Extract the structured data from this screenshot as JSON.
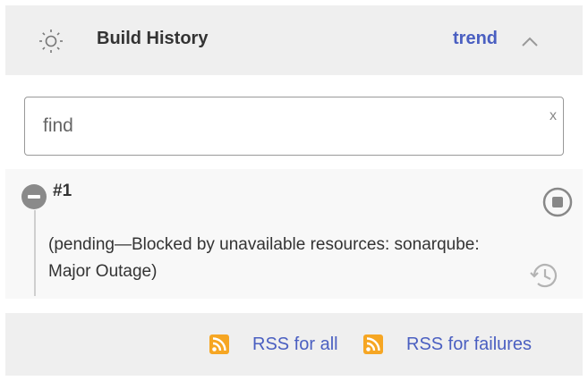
{
  "header": {
    "title": "Build History",
    "trend_label": "trend",
    "icon": "build-history-icon",
    "collapse_icon": "chevron-up-icon"
  },
  "search": {
    "placeholder": "find",
    "value": "",
    "clear_label": "x"
  },
  "builds": [
    {
      "number": "#1",
      "status": "pending",
      "status_icon": "status-ball-icon",
      "status_color": "#8a8a8a",
      "description": "(pending—Blocked by unavailable resources: sonarqube: Major Outage)",
      "actions": [
        "abort-icon",
        "history-icon"
      ]
    }
  ],
  "footer": {
    "rss_all_label": "RSS for all",
    "rss_failures_label": "RSS for failures",
    "rss_icon_color": "#f6a623"
  },
  "colors": {
    "link": "#4a5fc1",
    "header_bg": "#efefef",
    "row_bg": "#f8f8f8",
    "text": "#333333"
  }
}
